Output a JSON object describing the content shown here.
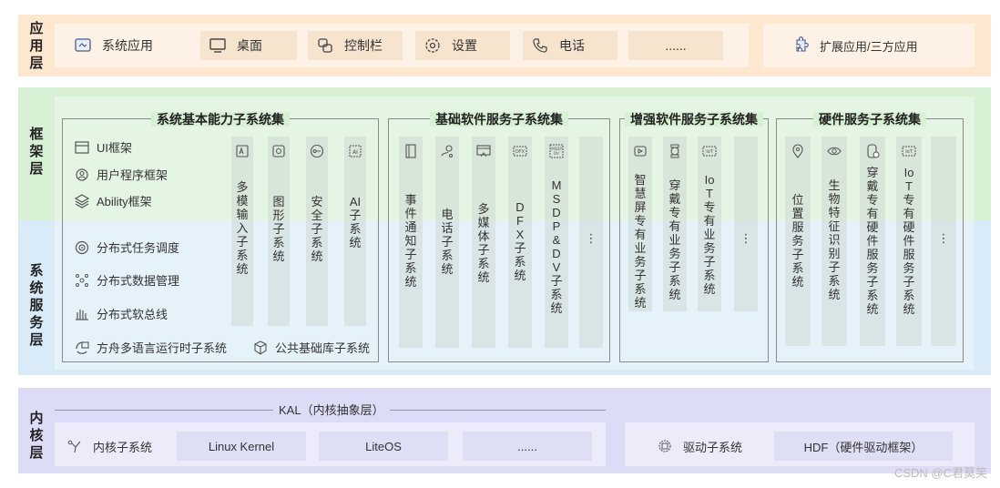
{
  "layers": {
    "app": "应用层",
    "framework": "框架层",
    "system": "系统服务层",
    "kernel": "内核层"
  },
  "app_items": [
    {
      "label": "系统应用",
      "icon": "system-app-icon"
    },
    {
      "label": "桌面",
      "icon": "desktop-icon"
    },
    {
      "label": "控制栏",
      "icon": "control-bar-icon"
    },
    {
      "label": "设置",
      "icon": "settings-gear-icon"
    },
    {
      "label": "电话",
      "icon": "phone-icon"
    },
    {
      "label": "......",
      "icon": ""
    }
  ],
  "app_ext": {
    "label": "扩展应用/三方应用",
    "icon": "puzzle-icon"
  },
  "basic_capability": {
    "title": "系统基本能力子系统集",
    "frameworks": [
      {
        "label": "UI框架",
        "icon": "ui-frame-icon"
      },
      {
        "label": "用户程序框架",
        "icon": "user-program-icon"
      },
      {
        "label": "Ability框架",
        "icon": "ability-layers-icon"
      }
    ],
    "services": [
      {
        "label": "分布式任务调度",
        "icon": "task-schedule-icon"
      },
      {
        "label": "分布式数据管理",
        "icon": "data-manage-icon"
      },
      {
        "label": "分布式软总线",
        "icon": "soft-bus-icon"
      }
    ],
    "bottom": [
      {
        "label": "方舟多语言运行时子系统",
        "icon": "ark-runtime-icon"
      },
      {
        "label": "公共基础库子系统",
        "icon": "cube-icon"
      }
    ],
    "columns": [
      {
        "label": "多模输入子系统",
        "icon": "input-icon"
      },
      {
        "label": "图形子系统",
        "icon": "graphics-icon"
      },
      {
        "label": "安全子系统",
        "icon": "key-icon"
      },
      {
        "label": "AI子系统",
        "icon": "ai-icon"
      }
    ]
  },
  "basic_software": {
    "title": "基础软件服务子系统集",
    "columns": [
      {
        "label": "事件通知子系统",
        "icon": "notification-icon"
      },
      {
        "label": "电话子系统",
        "icon": "telephony-icon"
      },
      {
        "label": "多媒体子系统",
        "icon": "media-icon"
      },
      {
        "label": "DFX子系统",
        "icon": "dfx-icon"
      },
      {
        "label": "MSDP&DV子系统",
        "icon": "msdp-icon"
      },
      {
        "label": "⋮",
        "icon": ""
      }
    ]
  },
  "enhanced_software": {
    "title": "增强软件服务子系统集",
    "columns": [
      {
        "label": "智慧屏专有业务子系统",
        "icon": "smart-screen-icon"
      },
      {
        "label": "穿戴专有业务子系统",
        "icon": "watch-icon"
      },
      {
        "label": "IoT专有业务子系统",
        "icon": "iot-icon"
      },
      {
        "label": "⋮",
        "icon": ""
      }
    ]
  },
  "hardware": {
    "title": "硬件服务子系统集",
    "columns": [
      {
        "label": "位置服务子系统",
        "icon": "location-icon"
      },
      {
        "label": "生物特征识别子系统",
        "icon": "eye-icon"
      },
      {
        "label": "穿戴专有硬件服务子系统",
        "icon": "wear-hw-icon"
      },
      {
        "label": "IoT专有硬件服务子系统",
        "icon": "iot-hw-icon"
      },
      {
        "label": "⋮",
        "icon": ""
      }
    ]
  },
  "kernel": {
    "kal": "KAL（内核抽象层）",
    "subsystem": "内核子系统",
    "items": [
      "Linux Kernel",
      "LiteOS",
      "......"
    ],
    "driver": "驱动子系统",
    "hdf": "HDF（硬件驱动框架）"
  },
  "watermark": "CSDN @C君莫笑"
}
